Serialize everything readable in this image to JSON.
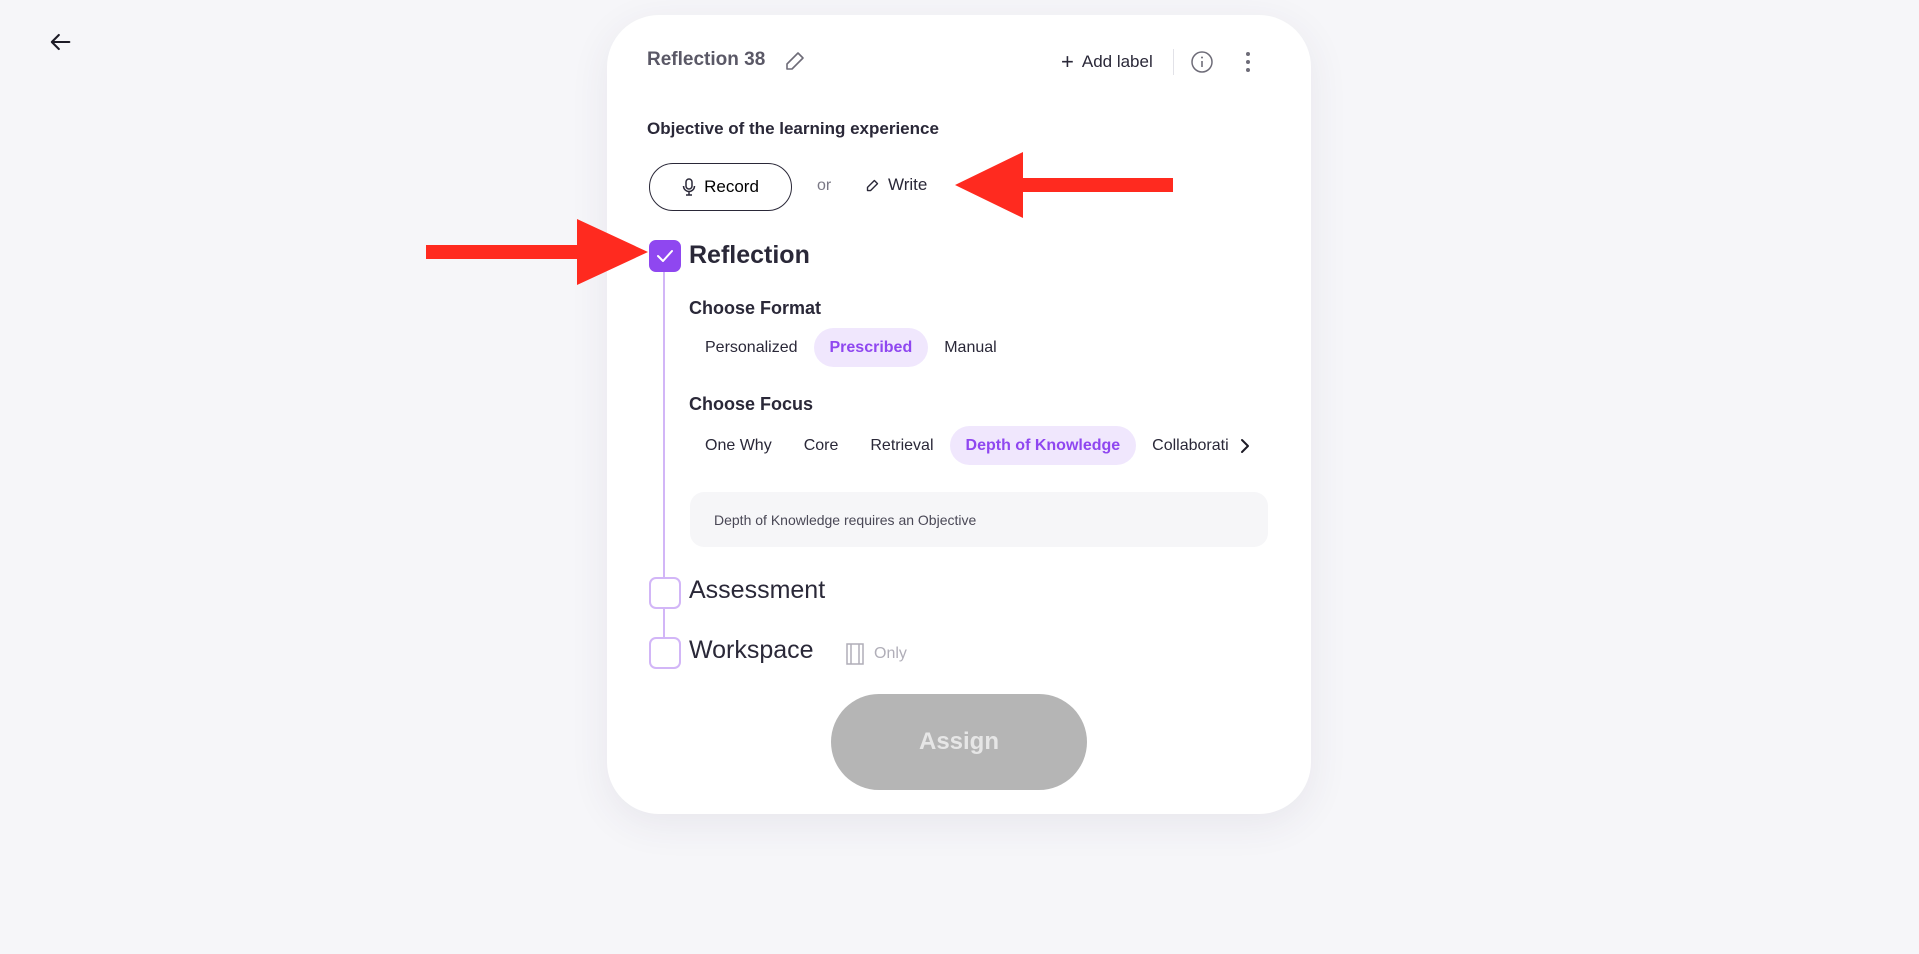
{
  "header": {
    "title": "Reflection 38",
    "add_label": "Add label"
  },
  "objective": {
    "label": "Objective of the learning experience",
    "record_label": "Record",
    "or_label": "or",
    "write_label": "Write"
  },
  "sections": {
    "reflection": {
      "label": "Reflection",
      "checked": true
    },
    "assessment": {
      "label": "Assessment",
      "checked": false
    },
    "workspace": {
      "label": "Workspace",
      "checked": false,
      "only_label": "Only"
    }
  },
  "format": {
    "heading": "Choose Format",
    "options": [
      "Personalized",
      "Prescribed",
      "Manual"
    ],
    "selected": "Prescribed"
  },
  "focus": {
    "heading": "Choose Focus",
    "options": [
      "One Why",
      "Core",
      "Retrieval",
      "Depth of Knowledge",
      "Collaboration"
    ],
    "selected": "Depth of Knowledge"
  },
  "note": "Depth of Knowledge requires an Objective",
  "assign_label": "Assign",
  "colors": {
    "accent": "#8f47f0",
    "accent_light": "#f0e7fd",
    "annotation_arrow": "#ff2a1f",
    "disabled": "#b5b5b5"
  }
}
